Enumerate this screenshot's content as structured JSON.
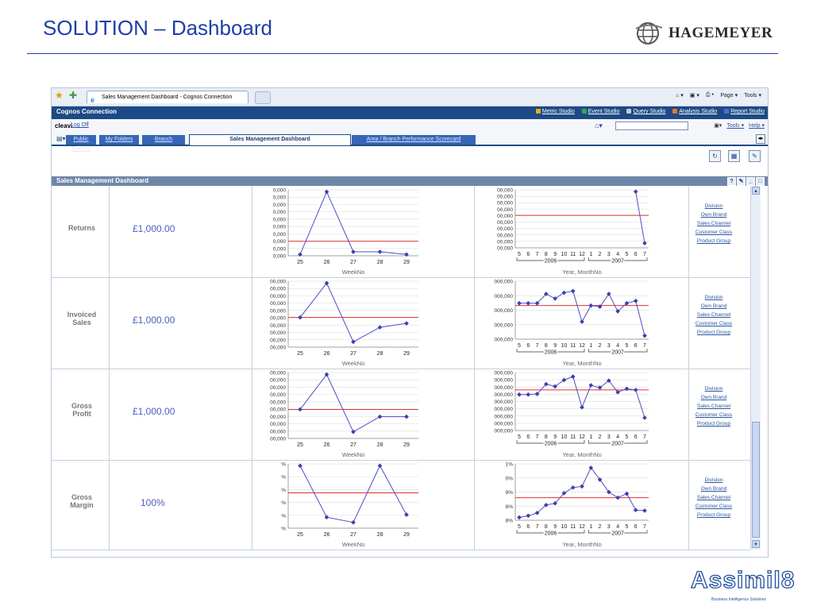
{
  "slide": {
    "title": "SOLUTION – Dashboard"
  },
  "brand": {
    "hagemeyer": "HAGEMEYER",
    "assimil8": "Assimil8",
    "assimil8_sub": "Business Intelligence Solutions"
  },
  "browser": {
    "tab_title": "Sales Management Dashboard - Cognos Connection",
    "tools": {
      "page": "Page ▾",
      "tools": "Tools ▾"
    }
  },
  "cognos": {
    "title": "Cognos Connection",
    "studios": [
      "Metric Studio",
      "Event Studio",
      "Query Studio",
      "Analysis Studio",
      "Report Studio"
    ],
    "studio_colors": [
      "#e0b020",
      "#3aa64a",
      "#c8c8c8",
      "#e8762a",
      "#4c6fd0"
    ],
    "user": "cleavi",
    "log_off": "Log Off",
    "tools_link": "Tools ▾",
    "help_link": "Help ▾",
    "tabs": [
      {
        "label": "Public Folders",
        "active": false
      },
      {
        "label": "My Folders",
        "active": false
      },
      {
        "label": "Branch",
        "active": false
      },
      {
        "label": "Sales Management Dashboard",
        "active": true
      },
      {
        "label": "Area / Branch Performance Scorecard",
        "active": false
      }
    ]
  },
  "dashboard": {
    "title": "Sales Management Dashboard",
    "link_labels": [
      "Division",
      "Own Brand",
      "Sales Channel",
      "Customer Class",
      "Product Group"
    ],
    "rows": [
      {
        "name_lines": [
          "Returns"
        ],
        "value": "£1,000.00"
      },
      {
        "name_lines": [
          "Invoiced",
          "Sales"
        ],
        "value": "£1,000.00"
      },
      {
        "name_lines": [
          "Gross",
          "Profit"
        ],
        "value": "£1,000.00"
      },
      {
        "name_lines": [
          "Gross",
          "Margin"
        ],
        "value": "100%"
      }
    ]
  },
  "chart_data": [
    {
      "type": "line",
      "xlabel": "WeekNo",
      "x": [
        25,
        26,
        27,
        28,
        29
      ],
      "y_tick_labels": [
        "0,000",
        "0,000",
        "0,000",
        "0,000",
        "0,000",
        "0,000",
        "0,000",
        "0,000",
        "0,000",
        "0,000"
      ],
      "values": [
        0.02,
        0.97,
        0.06,
        0.06,
        0.02
      ],
      "reference": 0.22,
      "ylim": [
        0,
        1
      ]
    },
    {
      "type": "line",
      "xlabel": "Year, MonthNo",
      "x": [
        "5",
        "6",
        "7",
        "8",
        "9",
        "10",
        "11",
        "12",
        "1",
        "2",
        "3",
        "4",
        "5",
        "6",
        "7"
      ],
      "groups": [
        "2006",
        "2007"
      ],
      "y_tick_labels": [
        "00,000",
        "00,000",
        "00,000",
        "00,000",
        "00,000",
        "00,000",
        "00,000",
        "00,000",
        "00,000",
        "00,000"
      ],
      "values": [
        null,
        null,
        null,
        null,
        null,
        null,
        null,
        null,
        null,
        null,
        null,
        null,
        null,
        0.97,
        0.08
      ],
      "reference": 0.56,
      "ylim": [
        0,
        1
      ]
    },
    {
      "type": "line",
      "xlabel": "WeekNo",
      "x": [
        25,
        26,
        27,
        28,
        29
      ],
      "y_tick_labels": [
        "00,000",
        "00,000",
        "00,000",
        "00,000",
        "00,000",
        "00,000",
        "00,000",
        "00,000",
        "00,000",
        "00,000"
      ],
      "values": [
        0.45,
        0.97,
        0.08,
        0.3,
        0.36
      ],
      "reference": 0.45,
      "ylim": [
        0,
        1
      ]
    },
    {
      "type": "line",
      "xlabel": "Year, MonthNo",
      "x": [
        "5",
        "6",
        "7",
        "8",
        "9",
        "10",
        "11",
        "12",
        "1",
        "2",
        "3",
        "4",
        "5",
        "6",
        "7"
      ],
      "groups": [
        "2006",
        "2007"
      ],
      "y_tick_labels": [
        "000,000",
        "000,000",
        "000,000",
        "000,000",
        "000,000"
      ],
      "values": [
        0.62,
        0.62,
        0.62,
        0.78,
        0.7,
        0.8,
        0.83,
        0.3,
        0.58,
        0.56,
        0.78,
        0.48,
        0.62,
        0.66,
        0.06
      ],
      "reference": 0.58,
      "ylim": [
        0,
        1
      ]
    },
    {
      "type": "line",
      "xlabel": "WeekNo",
      "x": [
        25,
        26,
        27,
        28,
        29
      ],
      "y_tick_labels": [
        "00,000",
        "00,000",
        "00,000",
        "00,000",
        "00,000",
        "00,000",
        "00,000",
        "00,000",
        "00,000",
        "00,000"
      ],
      "values": [
        0.44,
        0.97,
        0.1,
        0.33,
        0.33
      ],
      "reference": 0.44,
      "ylim": [
        0,
        1
      ]
    },
    {
      "type": "line",
      "xlabel": "Year, MonthNo",
      "x": [
        "5",
        "6",
        "7",
        "8",
        "9",
        "10",
        "11",
        "12",
        "1",
        "2",
        "3",
        "4",
        "5",
        "6",
        "7"
      ],
      "groups": [
        "2006",
        "2007"
      ],
      "y_tick_labels": [
        "000,000",
        "000,000",
        "000,000",
        "000,000",
        "000,000",
        "000,000",
        "000,000",
        "000,000",
        "000,000"
      ],
      "values": [
        0.62,
        0.62,
        0.63,
        0.8,
        0.76,
        0.87,
        0.93,
        0.4,
        0.78,
        0.74,
        0.86,
        0.66,
        0.72,
        0.7,
        0.22
      ],
      "reference": 0.7,
      "ylim": [
        0,
        1
      ]
    },
    {
      "type": "line",
      "xlabel": "WeekNo",
      "x": [
        25,
        26,
        27,
        28,
        29
      ],
      "y_tick_labels": [
        "%",
        "%",
        "%",
        "%",
        "%",
        "%"
      ],
      "values": [
        0.97,
        0.17,
        0.09,
        0.97,
        0.21
      ],
      "reference": 0.55,
      "ylim": [
        0,
        1
      ]
    },
    {
      "type": "line",
      "xlabel": "Year, MonthNo",
      "x": [
        "5",
        "6",
        "7",
        "8",
        "9",
        "10",
        "11",
        "12",
        "1",
        "2",
        "3",
        "4",
        "5",
        "6",
        "7"
      ],
      "groups": [
        "2006",
        "2007"
      ],
      "y_tick_labels": [
        "1%",
        "0%",
        "9%",
        "8%",
        "8%"
      ],
      "values": [
        0.05,
        0.08,
        0.13,
        0.27,
        0.3,
        0.48,
        0.58,
        0.6,
        0.93,
        0.72,
        0.5,
        0.4,
        0.47,
        0.18,
        0.17
      ],
      "reference": 0.4,
      "ylim": [
        0,
        1
      ]
    }
  ]
}
